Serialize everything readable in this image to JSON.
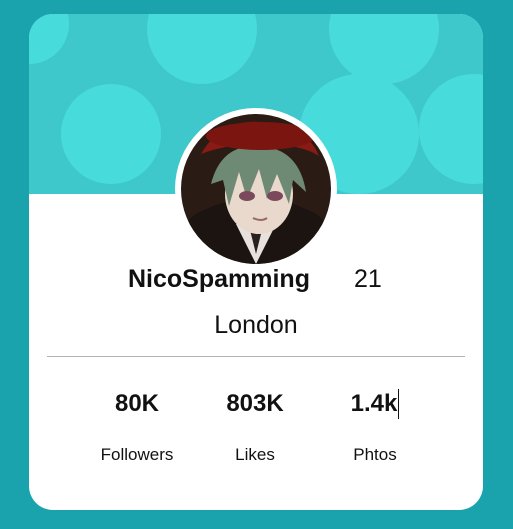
{
  "profile": {
    "username": "NicoSpamming",
    "age": "21",
    "location": "London",
    "avatar_icon": "anime-character-avatar"
  },
  "stats": [
    {
      "value": "80K",
      "label": "Followers"
    },
    {
      "value": "803K",
      "label": "Likes"
    },
    {
      "value": "1.4k",
      "label": "Phtos"
    }
  ],
  "colors": {
    "background": "#1aa3ad",
    "banner": "#3ec8cc",
    "bubble": "#48dbdc",
    "card": "#ffffff"
  }
}
